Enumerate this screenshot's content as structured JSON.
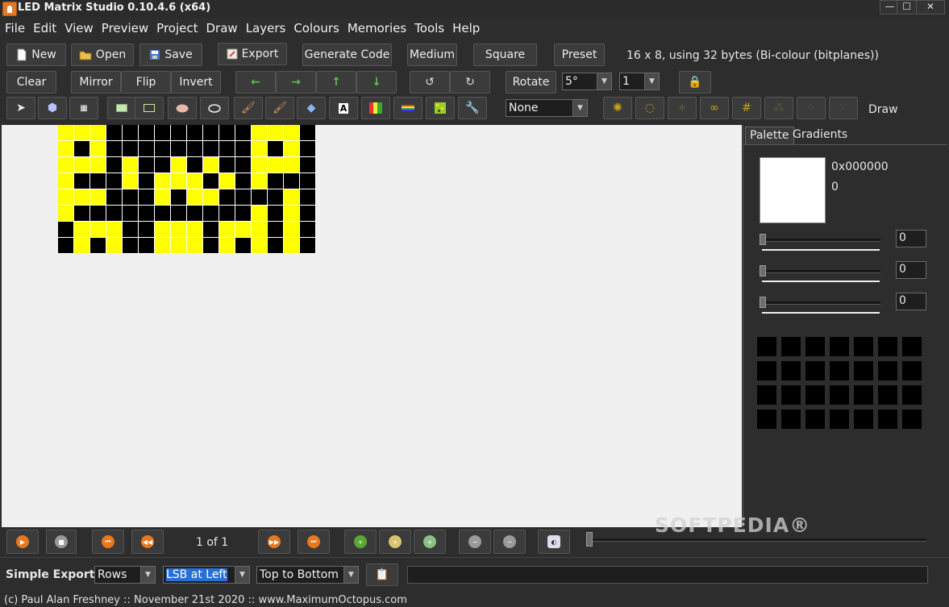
{
  "window": {
    "title": "LED Matrix Studio 0.10.4.6 (x64)",
    "controls": [
      "—",
      "☐",
      "✕"
    ]
  },
  "menu": [
    "File",
    "Edit",
    "View",
    "Preview",
    "Project",
    "Draw",
    "Layers",
    "Colours",
    "Memories",
    "Tools",
    "Help"
  ],
  "toolbar1": {
    "new_label": "New",
    "open_label": "Open",
    "save_label": "Save",
    "export_label": "Export",
    "generate_code_label": "Generate Code",
    "medium_label": "Medium",
    "square_label": "Square",
    "preset_label": "Preset",
    "info": "16 x 8, using 32 bytes (Bi-colour (bitplanes))"
  },
  "toolbar2": {
    "clear_label": "Clear",
    "mirror_label": "Mirror",
    "flip_label": "Flip",
    "invert_label": "Invert",
    "rotate_label": "Rotate",
    "rotate_angle": "5°",
    "rotate_count": "1"
  },
  "toolbar3": {
    "gradient_select": "None",
    "draw_label": "Draw"
  },
  "matrix": {
    "columns": 16,
    "rows": 8,
    "on_color": "#ffff00",
    "off_color": "#000000",
    "pixels": [
      "1110000000001110",
      "1010000000001010",
      "1110100101001110",
      "1000101110101000",
      "1110001011000010",
      "1000000000001010",
      "0111001110111010",
      "0101001110101010"
    ]
  },
  "palette": {
    "tab_palette": "Palette",
    "tab_gradients": "Gradients",
    "hex_value": "0x000000",
    "index_value": "0",
    "sliders": [
      {
        "value": "0",
        "level": 0
      },
      {
        "value": "0",
        "level": 0
      },
      {
        "value": "0",
        "level": 0
      }
    ],
    "memory_slots": 28
  },
  "playback": {
    "frame_label": "1 of 1",
    "timeline_level": 0
  },
  "watermark": "SOFTPEDIA®",
  "export_bar": {
    "title": "Simple Export",
    "source": "Rows",
    "lsb": "LSB at Left",
    "direction": "Top to Bottom",
    "output": ""
  },
  "footer": "(c) Paul Alan Freshney :: November 21st 2020 :: www.MaximumOctopus.com",
  "colors": {
    "accent_orange": "#e8781e",
    "led_on": "#ffff00",
    "selection_blue": "#2a6fd6"
  }
}
